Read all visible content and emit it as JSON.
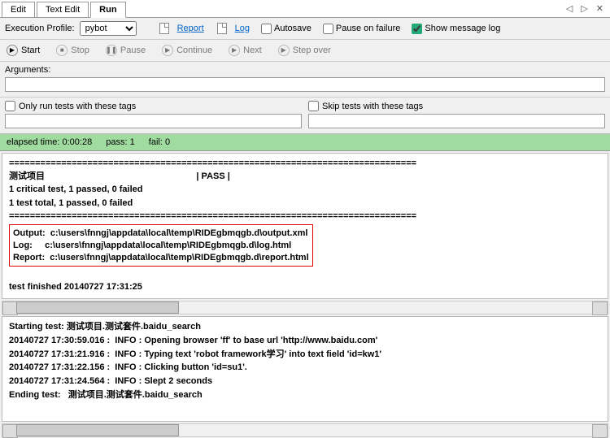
{
  "tabs": {
    "edit": "Edit",
    "textedit": "Text Edit",
    "run": "Run"
  },
  "nav": {
    "left": "◁",
    "right": "▷",
    "close": "✕"
  },
  "tb1": {
    "profile_label": "Execution Profile:",
    "profile": "pybot",
    "report": "Report",
    "log": "Log",
    "autosave": "Autosave",
    "pause_on_failure": "Pause on failure",
    "show_msg": "Show message log"
  },
  "tb2": {
    "start": "Start",
    "stop": "Stop",
    "pause": "Pause",
    "continue": "Continue",
    "next": "Next",
    "stepover": "Step over"
  },
  "args": {
    "label": "Arguments:",
    "value": ""
  },
  "tags": {
    "only": "Only run tests with these tags",
    "skip": "Skip tests with these tags"
  },
  "status": {
    "elapsed": "elapsed time: 0:00:28",
    "pass": "pass: 1",
    "fail": "fail: 0"
  },
  "console": {
    "sep": "==============================================================================",
    "title": "测试项目                                                             | PASS |",
    "crit": "1 critical test, 1 passed, 0 failed",
    "total": "1 test total, 1 passed, 0 failed",
    "out_lbl": "Output:  ",
    "out_val": "c:\\users\\fnngj\\appdata\\local\\temp\\RIDEgbmqgb.d\\output.xml",
    "log_lbl": "Log:     ",
    "log_val": "c:\\users\\fnngj\\appdata\\local\\temp\\RIDEgbmqgb.d\\log.html",
    "rep_lbl": "Report:  ",
    "rep_val": "c:\\users\\fnngj\\appdata\\local\\temp\\RIDEgbmqgb.d\\report.html",
    "finished": "test finished 20140727 17:31:25"
  },
  "logpane": {
    "l1": "Starting test: 测试项目.测试套件.baidu_search",
    "l2": "20140727 17:30:59.016 :  INFO : Opening browser 'ff' to base url 'http://www.baidu.com'",
    "l3": "20140727 17:31:21.916 :  INFO : Typing text 'robot framework学习' into text field 'id=kw1'",
    "l4": "20140727 17:31:22.156 :  INFO : Clicking button 'id=su1'.",
    "l5": "20140727 17:31:24.564 :  INFO : Slept 2 seconds",
    "l6": "Ending test:   测试项目.测试套件.baidu_search"
  }
}
